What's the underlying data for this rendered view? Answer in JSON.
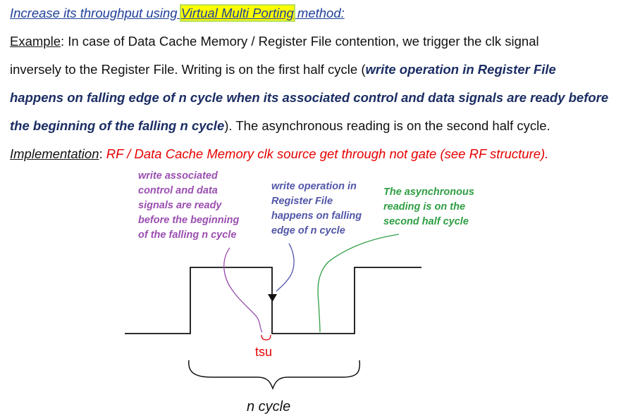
{
  "heading": {
    "prefix": "Increase its throughput using ",
    "highlight": "Virtual Multi Porting",
    "suffix": " method:"
  },
  "example": {
    "label": "Example",
    "line1_rest": ": In case of Data Cache Memory / Register File contention, we trigger the clk signal",
    "line2_plain": "inversely to the Register File. Writing is on the first half cycle (",
    "line2_bold": "write operation in Register File",
    "line3_bold": "happens on falling edge of n cycle when its associated control and data signals are ready before",
    "line4_bold": "the beginning of the falling n cycle",
    "line4_rest": "). The asynchronous reading is on the second half cycle."
  },
  "implementation": {
    "label": "Implementation",
    "colon": ":",
    "text": " RF / Data Cache Memory clk source get through not gate (see RF structure)."
  },
  "diagram": {
    "note_write_associated": "write associated\ncontrol and data\nsignals are ready\nbefore the beginning\nof the falling n cycle",
    "note_write_operation": "write operation in\nRegister File\nhappens on falling\nedge of n cycle",
    "note_async_reading": "The asynchronous\nreading is on the\nsecond half cycle",
    "tsu_label": "tsu",
    "n_cycle_label": "n cycle"
  },
  "colors": {
    "heading": "#1f3f9a",
    "highlight": "#ffff00",
    "bold_text": "#1b2d63",
    "red_text": "#e60000",
    "purple_note": "#9b4fb0",
    "blue_note": "#5256a8",
    "green_note": "#2f9e44"
  }
}
